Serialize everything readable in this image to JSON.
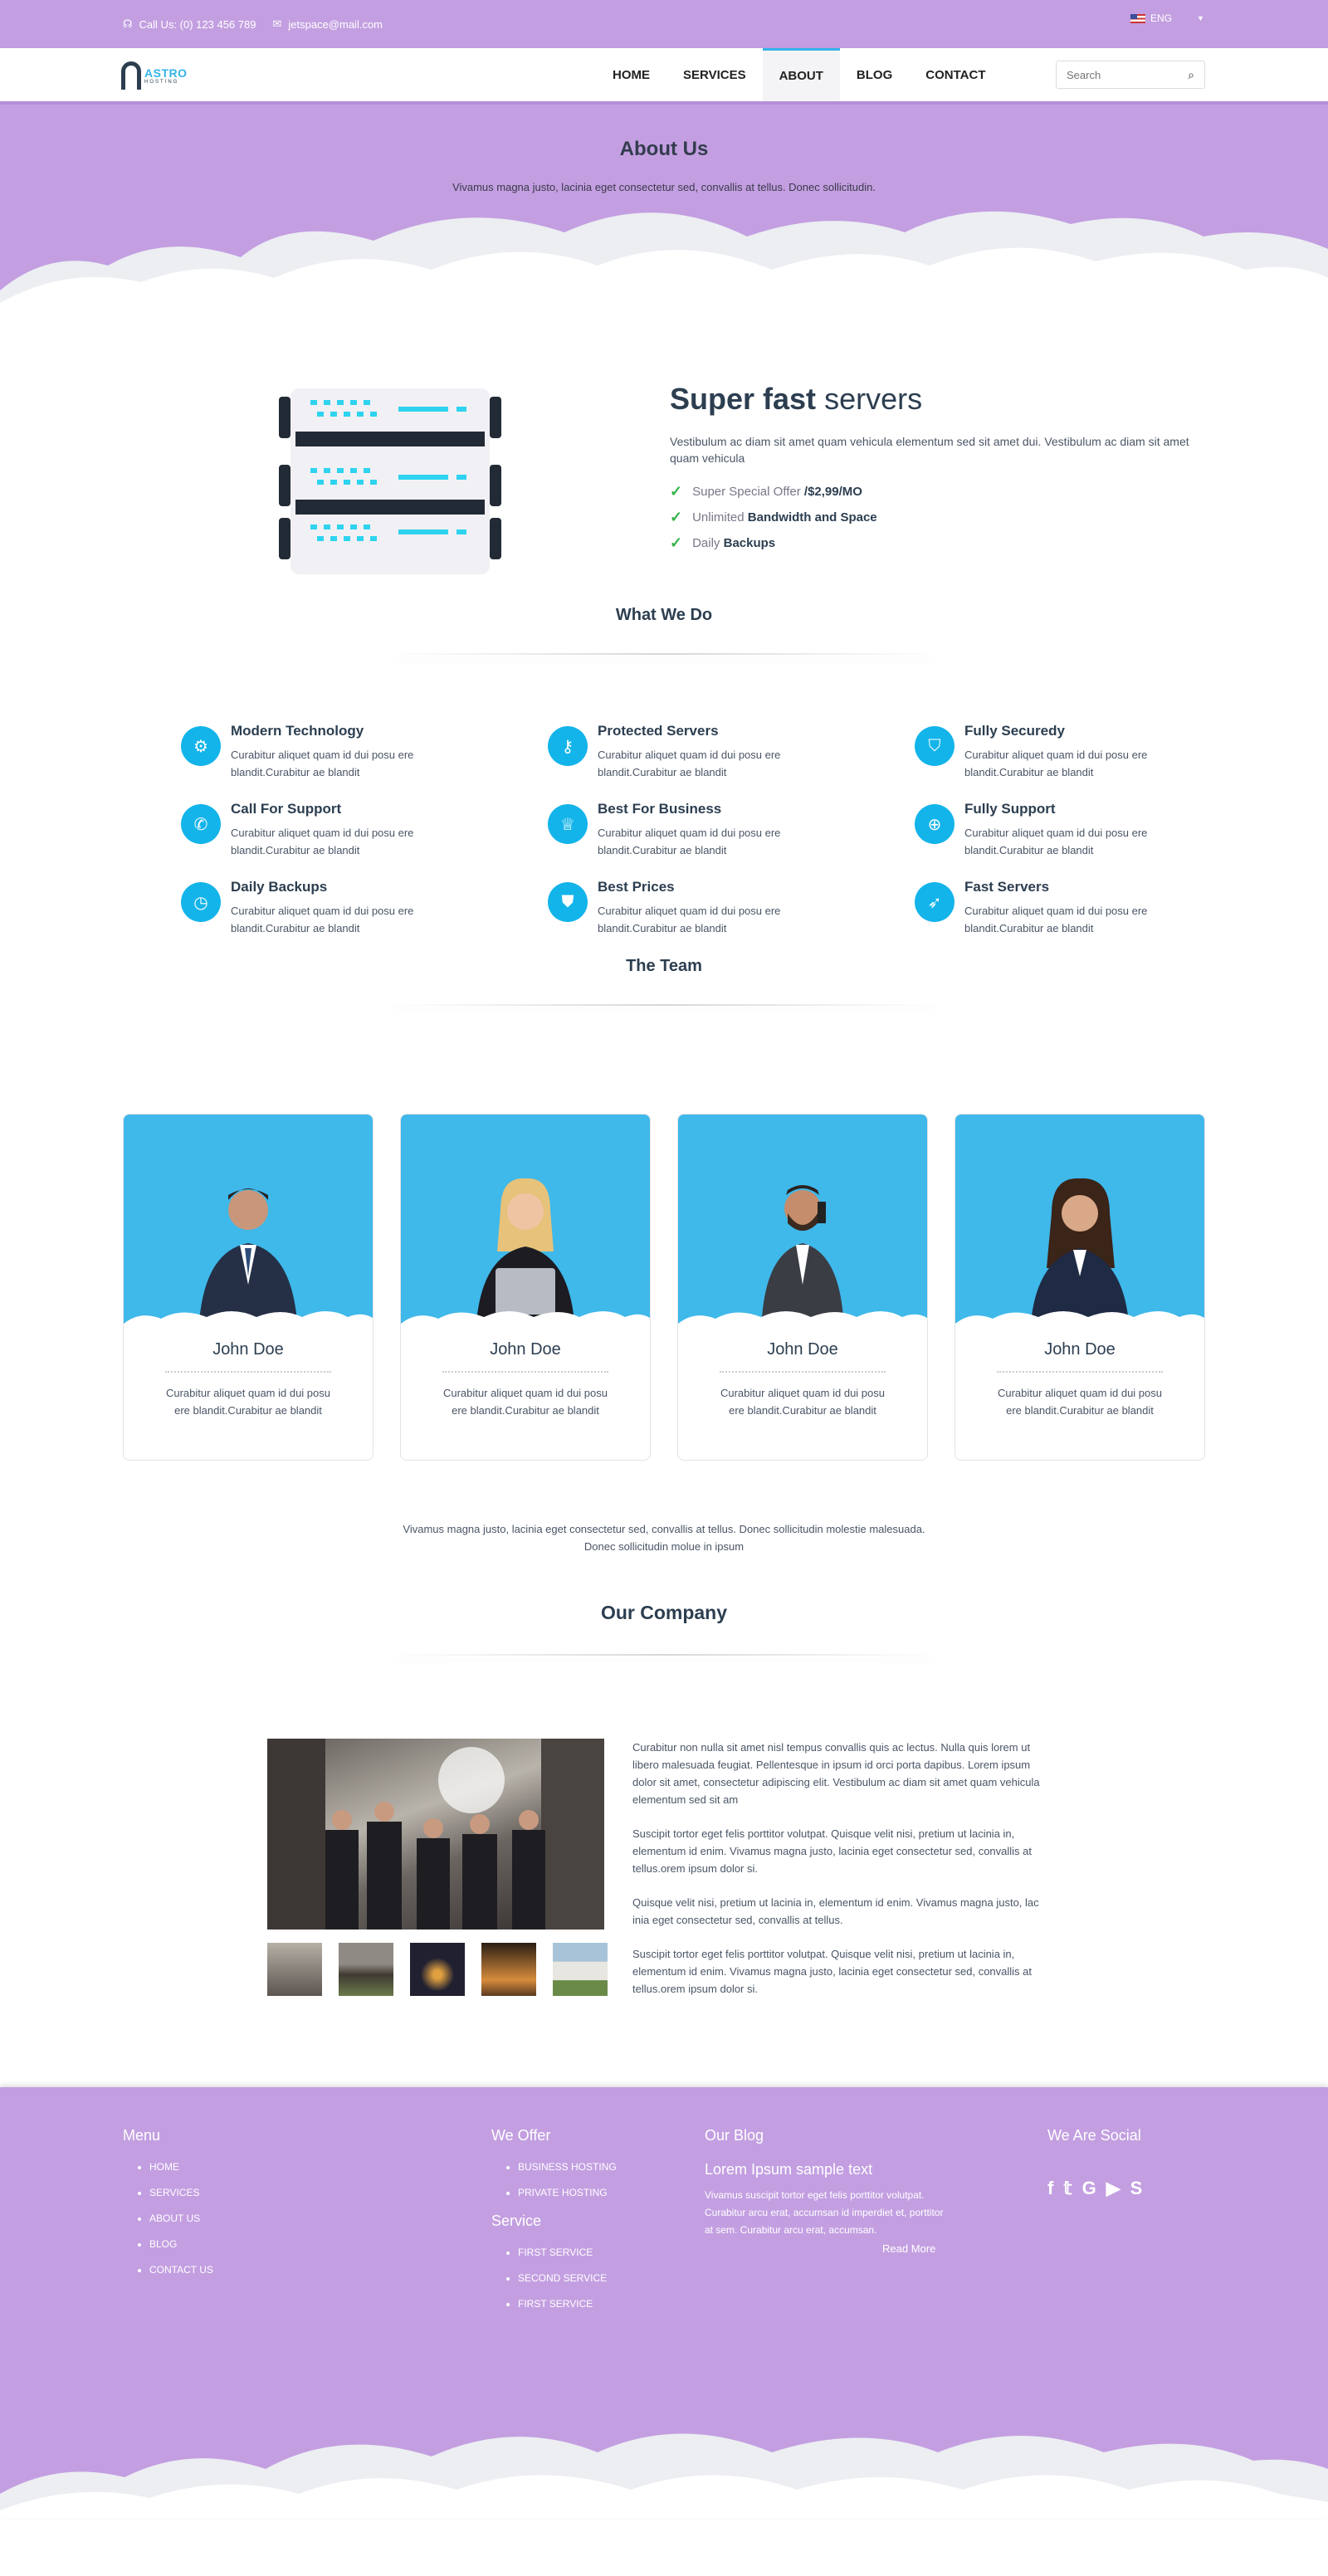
{
  "topbar": {
    "phone": "Call Us: (0) 123 456 789",
    "email": "jetspace@mail.com",
    "lang": "ENG"
  },
  "logo": {
    "name": "ASTRO",
    "sub": "HOSTING"
  },
  "nav": {
    "items": [
      "HOME",
      "SERVICES",
      "ABOUT",
      "BLOG",
      "CONTACT"
    ],
    "active": "ABOUT",
    "search_placeholder": "Search"
  },
  "hero": {
    "title": "About Us",
    "text": "Vivamus magna justo, lacinia eget consectetur sed, convallis at tellus. Donec sollicitudin."
  },
  "servers": {
    "title_bold": "Super fast",
    "title_light": "servers",
    "text": "Vestibulum ac diam sit amet quam vehicula elementum sed sit amet dui. Vestibulum ac diam sit amet quam vehicula",
    "list": [
      {
        "pre": "Super Special Offer",
        "strong": "/$2,99/MO"
      },
      {
        "pre": "Unlimited",
        "strong": "Bandwidth and Space"
      },
      {
        "pre": "Daily",
        "strong": "Backups"
      }
    ]
  },
  "what": {
    "title": "What We Do",
    "items": [
      {
        "title": "Modern Technology",
        "text": "Curabitur aliquet quam id dui posu ere blandit.Curabitur ae blandit",
        "icon": "gear-icon"
      },
      {
        "title": "Protected Servers",
        "text": "Curabitur aliquet quam id dui posu ere blandit.Curabitur ae blandit",
        "icon": "key-icon"
      },
      {
        "title": "Fully Securedy",
        "text": "Curabitur aliquet quam id dui posu ere blandit.Curabitur ae blandit",
        "icon": "shield-icon"
      },
      {
        "title": "Call For Support",
        "text": "Curabitur aliquet quam id dui posu ere blandit.Curabitur ae blandit",
        "icon": "phone-icon"
      },
      {
        "title": "Best For Business",
        "text": "Curabitur aliquet quam id dui posu ere blandit.Curabitur ae blandit",
        "icon": "trophy-icon"
      },
      {
        "title": "Fully Support",
        "text": "Curabitur aliquet quam id dui posu ere blandit.Curabitur ae blandit",
        "icon": "lifebuoy-icon"
      },
      {
        "title": "Daily Backups",
        "text": "Curabitur aliquet quam id dui posu ere blandit.Curabitur ae blandit",
        "icon": "clock-icon"
      },
      {
        "title": "Best Prices",
        "text": "Curabitur aliquet quam id dui posu ere blandit.Curabitur ae blandit",
        "icon": "tag-icon"
      },
      {
        "title": "Fast Servers",
        "text": "Curabitur aliquet quam id dui posu ere blandit.Curabitur ae blandit",
        "icon": "rocket-icon"
      }
    ]
  },
  "team": {
    "title": "The Team",
    "members": [
      {
        "name": "John Doe",
        "text": "Curabitur aliquet quam id dui posu ere blandit.Curabitur ae blandit"
      },
      {
        "name": "John Doe",
        "text": "Curabitur aliquet quam id dui posu ere blandit.Curabitur ae blandit"
      },
      {
        "name": "John Doe",
        "text": "Curabitur aliquet quam id dui posu ere blandit.Curabitur ae blandit"
      },
      {
        "name": "John Doe",
        "text": "Curabitur aliquet quam id dui posu ere blandit.Curabitur ae blandit"
      }
    ],
    "note": "Vivamus magna justo, lacinia eget consectetur sed, convallis at tellus. Donec sollicitudin molestie malesuada. Donec sollicitudin molue in ipsum"
  },
  "company": {
    "title": "Our Company",
    "paras": [
      "Curabitur non nulla sit amet nisl tempus convallis quis ac lectus. Nulla quis lorem ut libero malesuada feugiat. Pellentesque in ipsum id orci porta dapibus. Lorem ipsum dolor sit amet, consectetur adipiscing elit. Vestibulum ac diam sit amet quam vehicula elementum sed sit am",
      "Suscipit tortor eget felis porttitor volutpat. Quisque velit nisi, pretium ut lacinia in, elementum id enim. Vivamus magna justo, lacinia eget consectetur sed, convallis at tellus.orem ipsum dolor si.",
      "Quisque velit nisi, pretium ut lacinia in, elementum id enim. Vivamus magna justo, lac inia eget consectetur sed, convallis at tellus.",
      "Suscipit tortor eget felis porttitor volutpat. Quisque velit nisi, pretium ut lacinia in, elementum id enim. Vivamus magna justo, lacinia eget consectetur sed, convallis at tellus.orem ipsum dolor si."
    ]
  },
  "footer": {
    "menu_title": "Menu",
    "menu": [
      "HOME",
      "SERVICES",
      "ABOUT US",
      "BLOG",
      "CONTACT US"
    ],
    "offer_title": "We Offer",
    "offer": [
      "BUSINESS HOSTING",
      "PRIVATE HOSTING"
    ],
    "service_title": "Service",
    "service": [
      "FIRST SERVICE",
      "SECOND SERVICE",
      "FIRST SERVICE"
    ],
    "blog_title": "Our Blog",
    "blog_heading": "Lorem Ipsum sample text",
    "blog_text": "Vivamus suscipit tortor eget felis porttitor volutpat. Curabitur arcu erat, accumsan id imperdiet et, porttitor at sem. Curabitur arcu erat, accumsan.",
    "read_more": "Read More",
    "social_title": "We Are Social",
    "social_icons": [
      "facebook-icon",
      "twitter-icon",
      "google-icon",
      "youtube-icon",
      "skype-icon"
    ]
  },
  "colors": {
    "accent": "#13b4ea",
    "purple": "#c39fe1",
    "dark": "#2c3e50"
  }
}
